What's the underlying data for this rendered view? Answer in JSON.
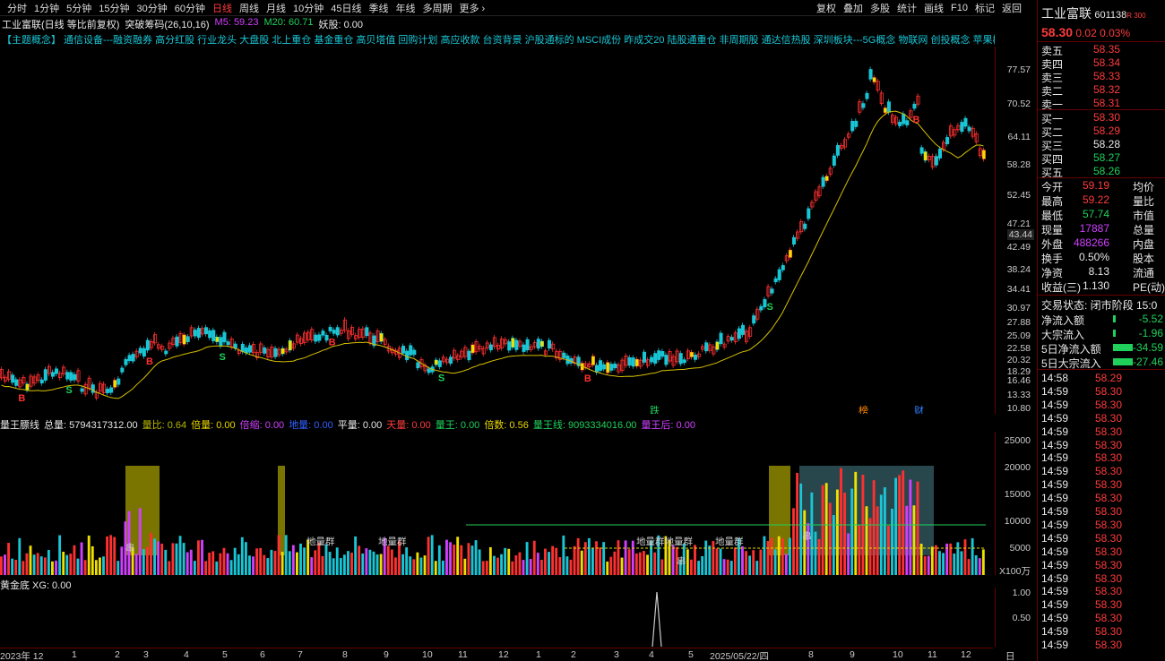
{
  "tabs": [
    "分时",
    "1分钟",
    "5分钟",
    "15分钟",
    "30分钟",
    "60分钟",
    "日线",
    "周线",
    "月线",
    "10分钟",
    "45日线",
    "季线",
    "年线",
    "多周期",
    "更多 ›"
  ],
  "active_tab": "日线",
  "right_tools": [
    "复权",
    "叠加",
    "多股",
    "统计",
    "画线",
    "F10",
    "标记",
    "返回"
  ],
  "info": {
    "stock": "工业富联(日线 等比前复权)",
    "indicator": "突破筹码(26,10,16)",
    "ma5": "M5: 59.23",
    "ma20": "M20: 60.71",
    "yao": "妖股: 0.00"
  },
  "concepts": "【主题概念】    通信设备---融资融券 高分红股 行业龙头 大盘股 北上重仓 基金重仓 高贝塔值 回购计划 高应收款 台资背景 沪股通标的 MSCI成份 昨成交20 陆股通重仓 非周期股 通达信热股 深圳板块---5G概念 物联网 创投概念 苹果概念 消费电子概念",
  "price_axis": [
    "77.57",
    "70.52",
    "64.11",
    "58.28",
    "52.45",
    "47.21",
    "42.49",
    "38.24",
    "34.41",
    "30.97",
    "27.88",
    "25.09",
    "22.58",
    "20.32",
    "18.29",
    "16.46",
    "13.33",
    "10.80"
  ],
  "price_marker": "43.44",
  "vol_header": [
    {
      "t": "量王膘线",
      "c": "white"
    },
    {
      "t": "总量: 5794317312.00",
      "c": "white"
    },
    {
      "t": "量比: 0.64",
      "c": "olive"
    },
    {
      "t": "倍量: 0.00",
      "c": "yellow"
    },
    {
      "t": "倍缩: 0.00",
      "c": "mag"
    },
    {
      "t": "地量: 0.00",
      "c": "blue"
    },
    {
      "t": "平量: 0.00",
      "c": "white"
    },
    {
      "t": "天量: 0.00",
      "c": "red"
    },
    {
      "t": "量王: 0.00",
      "c": "green"
    },
    {
      "t": "倍数: 0.56",
      "c": "yellow"
    },
    {
      "t": "量王线: 9093334016.00",
      "c": "green"
    },
    {
      "t": "量王后: 0.00",
      "c": "mag"
    }
  ],
  "vol_axis": [
    "25000",
    "20000",
    "15000",
    "10000",
    "5000",
    "X100万"
  ],
  "vol_labels": [
    "地量群",
    "地量群",
    "地量群地量群",
    "地量群",
    "串",
    "串",
    "串"
  ],
  "gold_header": "黄金底  XG: 0.00",
  "gold_axis": [
    "1.00",
    "0.50"
  ],
  "dates": [
    "2023年 12",
    "1",
    "2",
    "3",
    "4",
    "5",
    "6",
    "7",
    "8",
    "9",
    "10",
    "11",
    "12",
    "1",
    "2",
    "3",
    "4",
    "5",
    "2025/05/22/四",
    "8",
    "9",
    "10",
    "11",
    "12",
    "日线"
  ],
  "event_marks": [
    "跌",
    "榜",
    "财"
  ],
  "quote": {
    "name": "工业富联",
    "code": "601138",
    "badge": "R 300",
    "price": "58.30",
    "chg": "0.02",
    "pct": "0.03%",
    "asks": [
      [
        "卖五",
        "58.35"
      ],
      [
        "卖四",
        "58.34"
      ],
      [
        "卖三",
        "58.33"
      ],
      [
        "卖二",
        "58.32"
      ],
      [
        "卖一",
        "58.31"
      ]
    ],
    "bids": [
      [
        "买一",
        "58.30"
      ],
      [
        "买二",
        "58.29"
      ],
      [
        "买三",
        "58.28"
      ],
      [
        "买四",
        "58.27"
      ],
      [
        "买五",
        "58.26"
      ]
    ],
    "stats": [
      [
        "今开",
        "59.19",
        "均价"
      ],
      [
        "最高",
        "59.22",
        "量比"
      ],
      [
        "最低",
        "57.74",
        "市值"
      ],
      [
        "现量",
        "17887",
        "总量"
      ],
      [
        "外盘",
        "488266",
        "内盘"
      ],
      [
        "换手",
        "0.50%",
        "股本"
      ],
      [
        "净资",
        "8.13",
        "流通"
      ],
      [
        "收益(三)",
        "1.130",
        "PE(动)"
      ]
    ],
    "status": "交易状态: 闭市阶段  15:0",
    "flows": [
      [
        "净流入额",
        "-5.52"
      ],
      [
        "大宗流入",
        "-1.96"
      ],
      [
        "5日净流入额",
        "-34.59"
      ],
      [
        "5日大宗流入",
        "-27.46"
      ]
    ],
    "ticks": [
      [
        "14:58",
        "58.29"
      ],
      [
        "14:59",
        "58.30"
      ],
      [
        "14:59",
        "58.30"
      ],
      [
        "14:59",
        "58.30"
      ],
      [
        "14:59",
        "58.30"
      ],
      [
        "14:59",
        "58.30"
      ],
      [
        "14:59",
        "58.30"
      ],
      [
        "14:59",
        "58.30"
      ],
      [
        "14:59",
        "58.30"
      ],
      [
        "14:59",
        "58.30"
      ],
      [
        "14:59",
        "58.30"
      ],
      [
        "14:59",
        "58.30"
      ],
      [
        "14:59",
        "58.30"
      ],
      [
        "14:59",
        "58.30"
      ],
      [
        "14:59",
        "58.30"
      ],
      [
        "14:59",
        "58.30"
      ],
      [
        "14:59",
        "58.30"
      ],
      [
        "14:59",
        "58.30"
      ],
      [
        "14:59",
        "58.30"
      ],
      [
        "14:59",
        "58.30"
      ],
      [
        "14:59",
        "58.30"
      ]
    ]
  }
}
